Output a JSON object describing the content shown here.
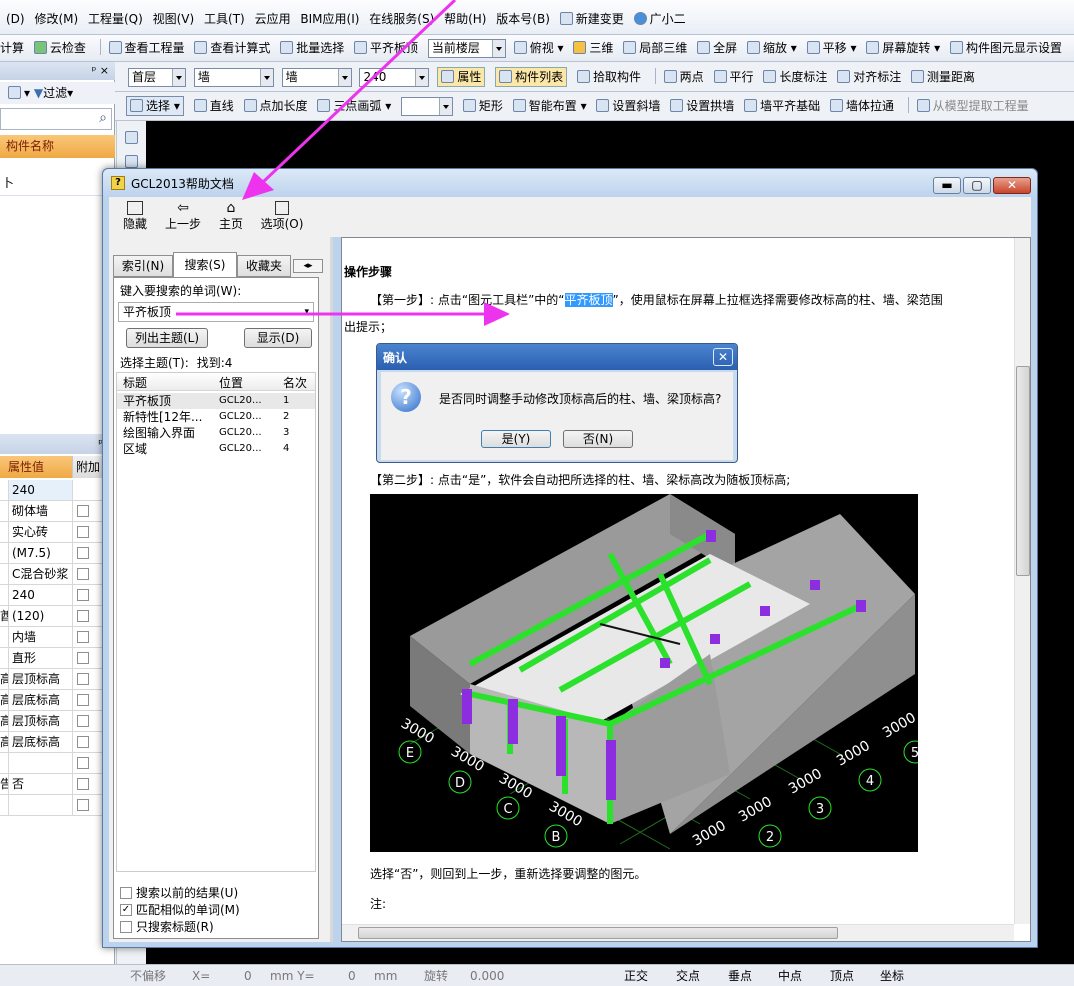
{
  "menu": [
    "(D)",
    "修改(M)",
    "工程量(Q)",
    "视图(V)",
    "工具(T)",
    "云应用",
    "BIM应用(I)",
    "在线服务(S)",
    "帮助(H)",
    "版本号(B)",
    "新建变更",
    "广小二"
  ],
  "toolbar1": {
    "items": [
      "计算",
      "云检查",
      "查看工程量",
      "查看计算式",
      "批量选择",
      "平齐板顶"
    ],
    "floor_combo": "当前楼层",
    "items2": [
      "俯视",
      "三维",
      "局部三维",
      "全屏",
      "缩放",
      "平移",
      "屏幕旋转",
      "构件图元显示设置"
    ]
  },
  "toolbar2": {
    "combos": [
      "首层",
      "墙",
      "墙",
      "240"
    ],
    "items": [
      "属性",
      "构件列表",
      "拾取构件",
      "两点",
      "平行",
      "长度标注",
      "对齐标注",
      "测量距离"
    ]
  },
  "toolbar3": {
    "items": [
      "选择",
      "直线",
      "点加长度",
      "三点画弧",
      "矩形",
      "智能布置",
      "设置斜墙",
      "设置拱墙",
      "墙平齐基础",
      "墙体拉通",
      "从模型提取工程量"
    ]
  },
  "left_panel": {
    "filter": "过滤",
    "col_header": "构件名称",
    "first_item": "卜"
  },
  "props": {
    "headers": [
      "属性值",
      "附加"
    ],
    "rows": [
      {
        "pre": "",
        "val": "240"
      },
      {
        "pre": "",
        "val": "砌体墙"
      },
      {
        "pre": "",
        "val": "实心砖"
      },
      {
        "pre": "",
        "val": "(M7.5)"
      },
      {
        "pre": "",
        "val": "C混合砂浆"
      },
      {
        "pre": "",
        "val": "240"
      },
      {
        "pre": "酋",
        "val": "(120)"
      },
      {
        "pre": "",
        "val": "内墙"
      },
      {
        "pre": "",
        "val": "直形"
      },
      {
        "pre": "高",
        "val": "层顶标高"
      },
      {
        "pre": "高",
        "val": "层底标高"
      },
      {
        "pre": "高",
        "val": "层顶标高"
      },
      {
        "pre": "高",
        "val": "层底标高"
      },
      {
        "pre": "",
        "val": ""
      },
      {
        "pre": "告",
        "val": "否"
      },
      {
        "pre": "",
        "val": ""
      }
    ]
  },
  "help": {
    "title": "GCL2013帮助文档",
    "tools": [
      "隐藏",
      "上一步",
      "主页",
      "选项(O)"
    ],
    "tabs": [
      "索引(N)",
      "搜索(S)",
      "收藏夹"
    ],
    "search_label": "键入要搜索的单词(W):",
    "search_value": "平齐板顶",
    "list_topics_btn": "列出主题(L)",
    "display_btn": "显示(D)",
    "select_label": "选择主题(T):",
    "found": "找到:4",
    "headers": [
      "标题",
      "位置",
      "名次"
    ],
    "topics": [
      [
        "平齐板顶",
        "GCL20...",
        "1"
      ],
      [
        "新特性[12年...",
        "GCL20...",
        "2"
      ],
      [
        "绘图输入界面",
        "GCL20...",
        "3"
      ],
      [
        "区域",
        "GCL20...",
        "4"
      ]
    ],
    "options": [
      "搜索以前的结果(U)",
      "匹配相似的单词(M)",
      "只搜索标题(R)"
    ],
    "heading": "操作步骤",
    "step1_pre": "【第一步】: 点击“图元工具栏”中的“",
    "step1_hl": "平齐板顶",
    "step1_post": "”，使用鼠标在屏幕上拉框选择需要修改标高的柱、墙、梁范围",
    "step1_tail": "出提示；",
    "dialog_title": "确认",
    "dialog_msg": "是否同时调整手动修改顶标高后的柱、墙、梁顶标高?",
    "dialog_yes": "是(Y)",
    "dialog_no": "否(N)",
    "step2": "【第二步】: 点击“是”，软件会自动把所选择的柱、墙、梁标高改为随板顶标高;",
    "note1": "选择“否”，则回到上一步，重新选择要调整的图元。",
    "note2": "注:",
    "axis_labels": [
      "E",
      "D",
      "C",
      "B",
      "2",
      "3",
      "4",
      "5"
    ],
    "dim": "3000"
  },
  "status": {
    "items": [
      "不偏移",
      "X=",
      "0",
      "mm Y=",
      "0",
      "mm",
      "旋转",
      "0.000",
      "正交",
      "交点",
      "垂点",
      "中点",
      "顶点",
      "坐标"
    ]
  }
}
